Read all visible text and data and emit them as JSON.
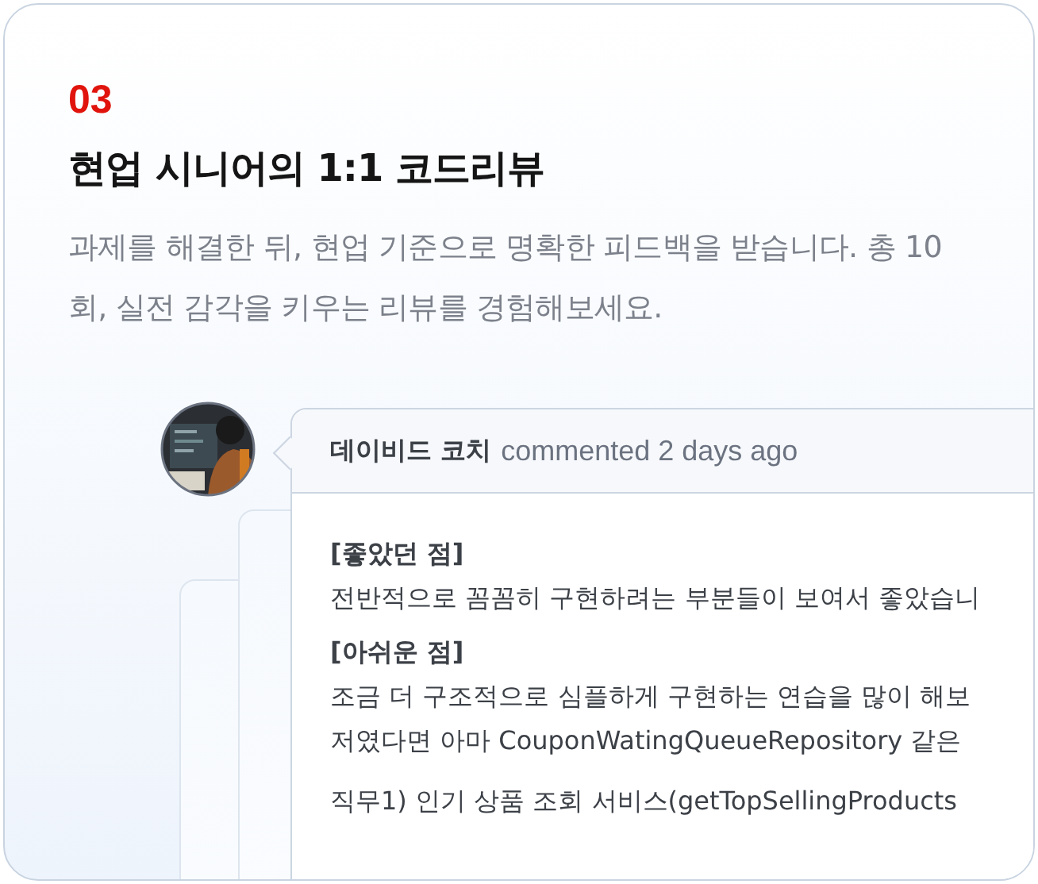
{
  "step": "03",
  "title": "현업 시니어의 1:1 코드리뷰",
  "description": "과제를 해결한 뒤, 현업 기준으로 명확한 피드백을 받습니다. 총 10회, 실전 감각을 키우는 리뷰를 경험해보세요.",
  "comment": {
    "author": "데이비드 코치",
    "meta": "commented 2 days ago",
    "body": [
      {
        "kind": "heading",
        "text": "[좋았던 점]"
      },
      {
        "kind": "line",
        "text": "전반적으로 꼼꼼히 구현하려는 부분들이 보여서 좋았습니"
      },
      {
        "kind": "heading",
        "text": "[아쉬운 점]"
      },
      {
        "kind": "line",
        "text": "조금 더 구조적으로 심플하게 구현하는 연습을 많이 해보"
      },
      {
        "kind": "line",
        "text": "저였다면 아마 CouponWatingQueueRepository 같은"
      },
      {
        "kind": "heading-line",
        "text": "직무1) 인기 상품 조회 서비스(getTopSellingProducts"
      }
    ]
  }
}
